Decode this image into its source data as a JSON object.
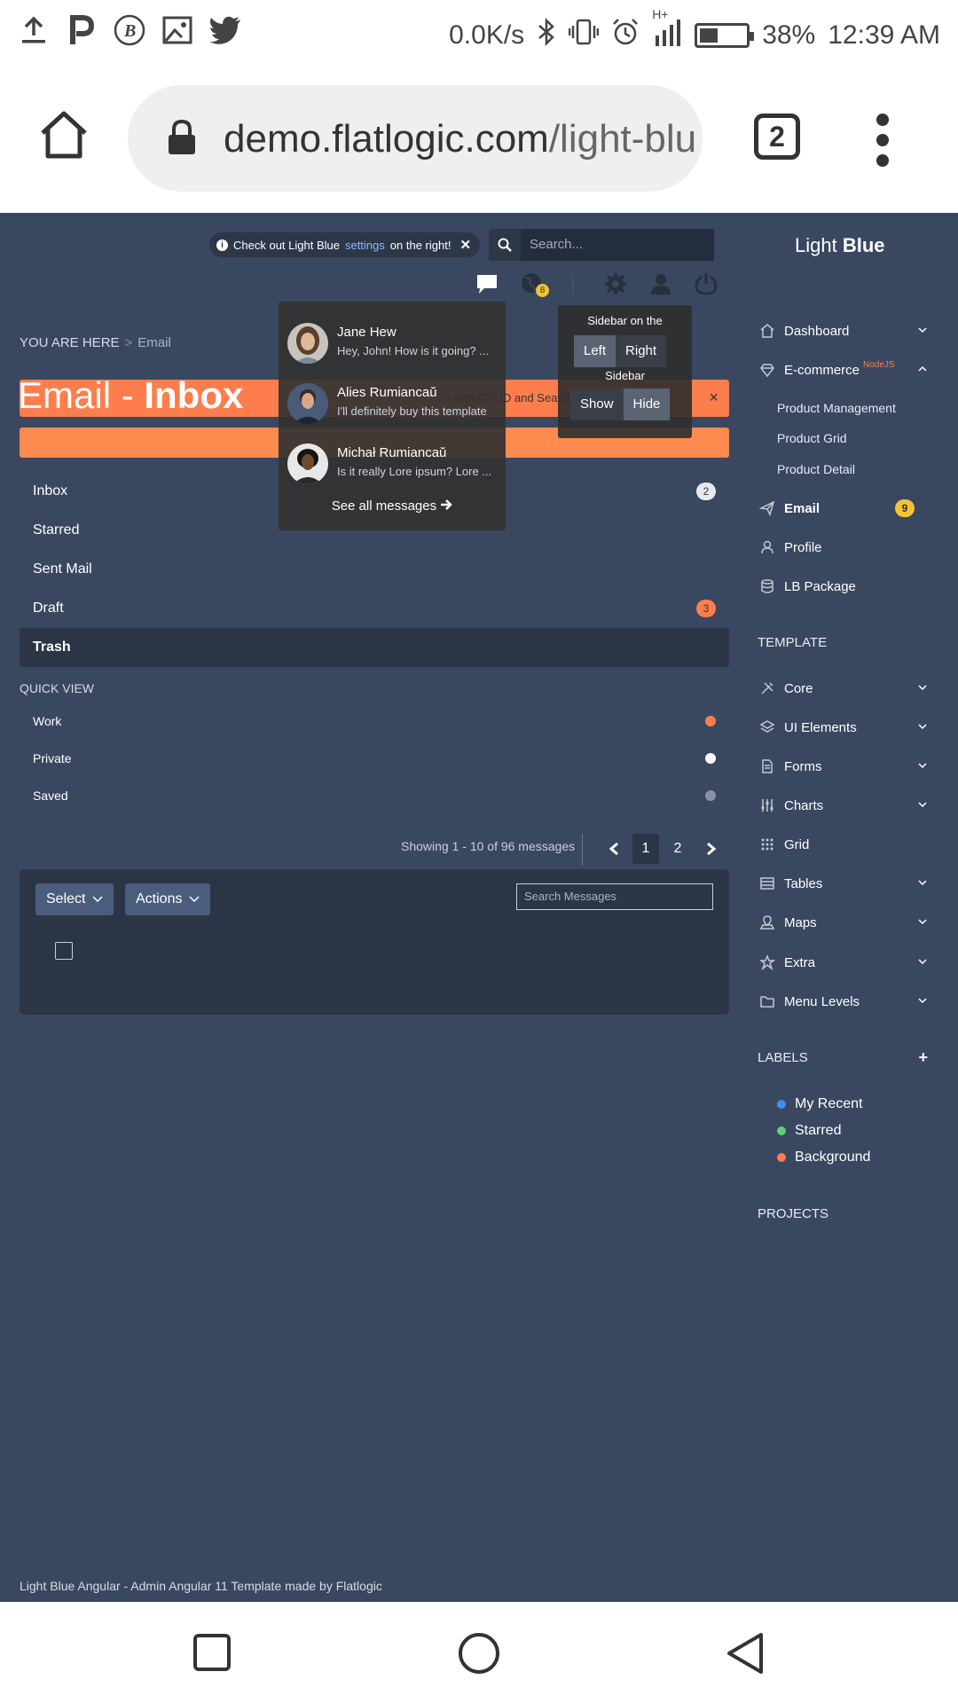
{
  "status_bar": {
    "net_speed": "0.0K/s",
    "network": "H+",
    "battery": "38%",
    "time": "12:39 AM"
  },
  "browser": {
    "url_host": "demo.flatlogic.com",
    "url_path": "/light-blu",
    "tab_count": "2"
  },
  "header": {
    "notice_pre": "Check out Light Blue",
    "notice_link": "settings",
    "notice_post": "on the right!",
    "notice_close": "✕",
    "search_placeholder": "Search...",
    "brand_light": "Light",
    "brand_bold": "Blue",
    "notifications_badge": "8"
  },
  "breadcrumb": {
    "prefix": "YOU ARE HERE",
    "separator": ">",
    "current": "Email"
  },
  "title": {
    "main": "Email - ",
    "bold": "Inbox"
  },
  "alert": {
    "text": "s with CRUD and Search",
    "close": "×"
  },
  "folders": [
    {
      "label": "Inbox",
      "count": "2"
    },
    {
      "label": "Starred",
      "count": ""
    },
    {
      "label": "Sent Mail",
      "count": ""
    },
    {
      "label": "Draft",
      "count": "3"
    },
    {
      "label": "Trash",
      "count": ""
    }
  ],
  "quick_view": {
    "title": "QUICK VIEW",
    "items": [
      {
        "label": "Work",
        "color": "#fd7d4d"
      },
      {
        "label": "Private",
        "color": "#ffffff"
      },
      {
        "label": "Saved",
        "color": "#8a93a6"
      }
    ]
  },
  "pagination": {
    "showing": "Showing 1 - 10 of 96 messages",
    "pages": [
      "1",
      "2"
    ]
  },
  "message_panel": {
    "select_label": "Select",
    "actions_label": "Actions",
    "search_placeholder": "Search Messages"
  },
  "messages_dropdown": {
    "items": [
      {
        "name": "Jane Hew",
        "text": "Hey, John! How is it going? ..."
      },
      {
        "name": "Alies Rumiancaŭ",
        "text": "I'll definitely buy this template"
      },
      {
        "name": "Michał Rumiancaŭ",
        "text": "Is it really Lore ipsum? Lore ..."
      }
    ],
    "see_all": "See all messages"
  },
  "settings_dropdown": {
    "sidebar_on_label": "Sidebar on the",
    "left": "Left",
    "right": "Right",
    "sidebar_label": "Sidebar",
    "show": "Show",
    "hide": "Hide"
  },
  "sidebar": {
    "items": [
      {
        "label": "Dashboard"
      },
      {
        "label": "E-commerce",
        "tag": "NodeJS"
      },
      {
        "label": "Email",
        "badge": "9"
      },
      {
        "label": "Profile"
      },
      {
        "label": "LB Package"
      }
    ],
    "ecommerce_sub": [
      "Product Management",
      "Product Grid",
      "Product Detail"
    ],
    "template_title": "TEMPLATE",
    "template_items": [
      {
        "label": "Core"
      },
      {
        "label": "UI Elements"
      },
      {
        "label": "Forms"
      },
      {
        "label": "Charts"
      },
      {
        "label": "Grid"
      },
      {
        "label": "Tables"
      },
      {
        "label": "Maps"
      },
      {
        "label": "Extra"
      },
      {
        "label": "Menu Levels"
      }
    ],
    "labels_title": "LABELS",
    "labels_add": "+",
    "labels": [
      {
        "label": "My Recent",
        "color": "#3b8ff4"
      },
      {
        "label": "Starred",
        "color": "#5fcf6a"
      },
      {
        "label": "Background",
        "color": "#fd7d4d"
      }
    ],
    "projects_title": "PROJECTS"
  },
  "footer": {
    "text": "Light Blue Angular - Admin Angular 11 Template made by Flatlogic"
  },
  "colors": {
    "app_bg": "#3a4760",
    "panel_bg": "#2c3546",
    "accent_orange": "#fd7d4d",
    "badge_yellow": "#f4c430"
  }
}
